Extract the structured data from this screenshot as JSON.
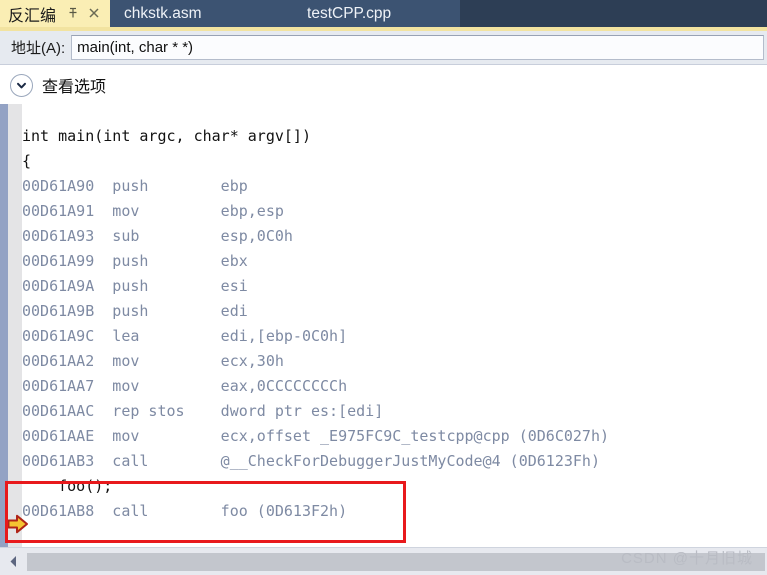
{
  "window": {
    "title": "反汇编"
  },
  "tabs": [
    {
      "label": "反汇编",
      "active": true,
      "pin_icon": "pin-icon",
      "close_icon": "close-icon"
    },
    {
      "label": "chkstk.asm",
      "active": false
    },
    {
      "label": "testCPP.cpp",
      "active": false
    }
  ],
  "address_bar": {
    "label": "地址(A):",
    "value": "main(int, char * *)",
    "placeholder": "main(int, char * *)"
  },
  "view_options": {
    "label": "查看选项",
    "icon": "chevron-down-icon",
    "expanded": true
  },
  "code": {
    "lines": [
      {
        "kind": "src",
        "text": "int main(int argc, char* argv[])"
      },
      {
        "kind": "src",
        "text": "{"
      },
      {
        "kind": "asm",
        "address": "00D61A90",
        "mnemonic": "push",
        "operands": "ebp"
      },
      {
        "kind": "asm",
        "address": "00D61A91",
        "mnemonic": "mov",
        "operands": "ebp,esp"
      },
      {
        "kind": "asm",
        "address": "00D61A93",
        "mnemonic": "sub",
        "operands": "esp,0C0h"
      },
      {
        "kind": "asm",
        "address": "00D61A99",
        "mnemonic": "push",
        "operands": "ebx"
      },
      {
        "kind": "asm",
        "address": "00D61A9A",
        "mnemonic": "push",
        "operands": "esi"
      },
      {
        "kind": "asm",
        "address": "00D61A9B",
        "mnemonic": "push",
        "operands": "edi"
      },
      {
        "kind": "asm",
        "address": "00D61A9C",
        "mnemonic": "lea",
        "operands": "edi,[ebp-0C0h]"
      },
      {
        "kind": "asm",
        "address": "00D61AA2",
        "mnemonic": "mov",
        "operands": "ecx,30h"
      },
      {
        "kind": "asm",
        "address": "00D61AA7",
        "mnemonic": "mov",
        "operands": "eax,0CCCCCCCCh"
      },
      {
        "kind": "asm",
        "address": "00D61AAC",
        "mnemonic": "rep stos",
        "operands": "dword ptr es:[edi]"
      },
      {
        "kind": "asm",
        "address": "00D61AAE",
        "mnemonic": "mov",
        "operands": "ecx,offset _E975FC9C_testcpp@cpp (0D6C027h)"
      },
      {
        "kind": "asm",
        "address": "00D61AB3",
        "mnemonic": "call",
        "operands": "@__CheckForDebuggerJustMyCode@4 (0D6123Fh)"
      },
      {
        "kind": "src",
        "text": "    foo();"
      },
      {
        "kind": "asm",
        "address": "00D61AB8",
        "mnemonic": "call",
        "operands": "foo (0D613F2h)",
        "current": true
      }
    ]
  },
  "highlight": {
    "color": "#e8191c",
    "marker_icon": "current-instruction-arrow-icon"
  },
  "scrollbar": {
    "left_arrow_icon": "scroll-left-arrow-icon",
    "orientation": "horizontal"
  },
  "watermark": {
    "text": "CSDN @十月旧城"
  },
  "colors": {
    "tab_active_bg": "#faeeb4",
    "tab_inactive_bg": "#3c5372",
    "tabbar_bg": "#2d3e55",
    "address_bar_bg": "#e6eaf0",
    "code_text_src": "#121212",
    "code_text_asm": "#7e8aa3",
    "highlight_box": "#e8191c",
    "ip_arrow": "#f5c431"
  }
}
